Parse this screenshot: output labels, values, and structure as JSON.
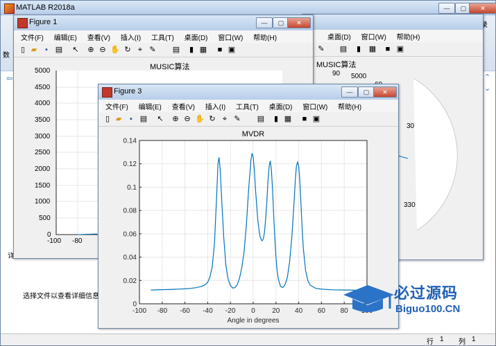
{
  "matlab": {
    "title": "MATLAB R2018a",
    "corner_label": "录",
    "left_label": "数",
    "bottom_left_label": "详",
    "info_text": "选择文件以查看详细信息",
    "status_row_label": "行",
    "status_row_value": "1",
    "status_col_label": "列",
    "status_col_value": "1"
  },
  "figure1": {
    "title": "Figure 1",
    "menus": [
      "文件(F)",
      "编辑(E)",
      "查看(V)",
      "插入(I)",
      "工具(T)",
      "桌面(D)",
      "窗口(W)",
      "帮助(H)"
    ],
    "plot_title": "MUSIC算法",
    "yticks": [
      "5000",
      "4500",
      "4000",
      "3500",
      "3000",
      "2500",
      "2000",
      "1500",
      "1000",
      "500",
      "0"
    ],
    "xticks": [
      "-100",
      "-80"
    ]
  },
  "figure2": {
    "title": "Figure 2",
    "menus": [
      "桌面(D)",
      "窗口(W)",
      "帮助(H)"
    ],
    "plot_title": "MUSIC算法",
    "polar_labels": [
      "90",
      "5000",
      "60",
      "30",
      "330"
    ]
  },
  "figure3": {
    "title": "Figure 3",
    "menus": [
      "文件(F)",
      "编辑(E)",
      "查看(V)",
      "插入(I)",
      "工具(T)",
      "桌面(D)",
      "窗口(W)",
      "帮助(H)"
    ]
  },
  "chart_data": {
    "type": "line",
    "title": "MVDR",
    "xlabel": "Angle in degrees",
    "ylabel": "",
    "xlim": [
      -100,
      100
    ],
    "ylim": [
      0,
      0.14
    ],
    "xticks": [
      "-100",
      "-80",
      "-60",
      "-40",
      "-20",
      "0",
      "20",
      "40",
      "60",
      "80",
      "100"
    ],
    "yticks": [
      "0",
      "0.02",
      "0.04",
      "0.06",
      "0.08",
      "0.1",
      "0.12",
      "0.14"
    ],
    "grid": true,
    "series": [
      {
        "color": "#0072bd",
        "x": [
          -90,
          -80,
          -70,
          -60,
          -55,
          -50,
          -45,
          -42,
          -40,
          -38,
          -36,
          -34,
          -32,
          -31,
          -30,
          -29,
          -28,
          -26,
          -24,
          -22,
          -20,
          -18,
          -16,
          -14,
          -12,
          -10,
          -8,
          -6,
          -4,
          -2,
          -1,
          0,
          1,
          2,
          4,
          5,
          6,
          7,
          8,
          9,
          10,
          11,
          12,
          13,
          14,
          15,
          16,
          17,
          18,
          19,
          20,
          21,
          22,
          24,
          26,
          28,
          30,
          32,
          34,
          36,
          37,
          38,
          39,
          40,
          41,
          42,
          43,
          44,
          46,
          48,
          50,
          55,
          60,
          70,
          80,
          90
        ],
        "y": [
          0.0118,
          0.0121,
          0.0124,
          0.0128,
          0.0132,
          0.0138,
          0.015,
          0.0165,
          0.0185,
          0.023,
          0.032,
          0.052,
          0.095,
          0.12,
          0.1255,
          0.115,
          0.095,
          0.058,
          0.033,
          0.021,
          0.0155,
          0.0135,
          0.0138,
          0.0165,
          0.022,
          0.031,
          0.045,
          0.068,
          0.098,
          0.123,
          0.129,
          0.1255,
          0.115,
          0.098,
          0.072,
          0.064,
          0.058,
          0.055,
          0.054,
          0.056,
          0.062,
          0.073,
          0.088,
          0.105,
          0.118,
          0.1225,
          0.115,
          0.098,
          0.076,
          0.056,
          0.04,
          0.029,
          0.0215,
          0.0148,
          0.014,
          0.0165,
          0.0225,
          0.036,
          0.058,
          0.088,
          0.106,
          0.118,
          0.1215,
          0.118,
          0.105,
          0.085,
          0.065,
          0.048,
          0.029,
          0.02,
          0.016,
          0.0132,
          0.0125,
          0.012,
          0.0118,
          0.0117
        ]
      }
    ]
  },
  "watermark": {
    "brand_cn": "必过源码",
    "brand_en": "Biguo100.CN"
  }
}
